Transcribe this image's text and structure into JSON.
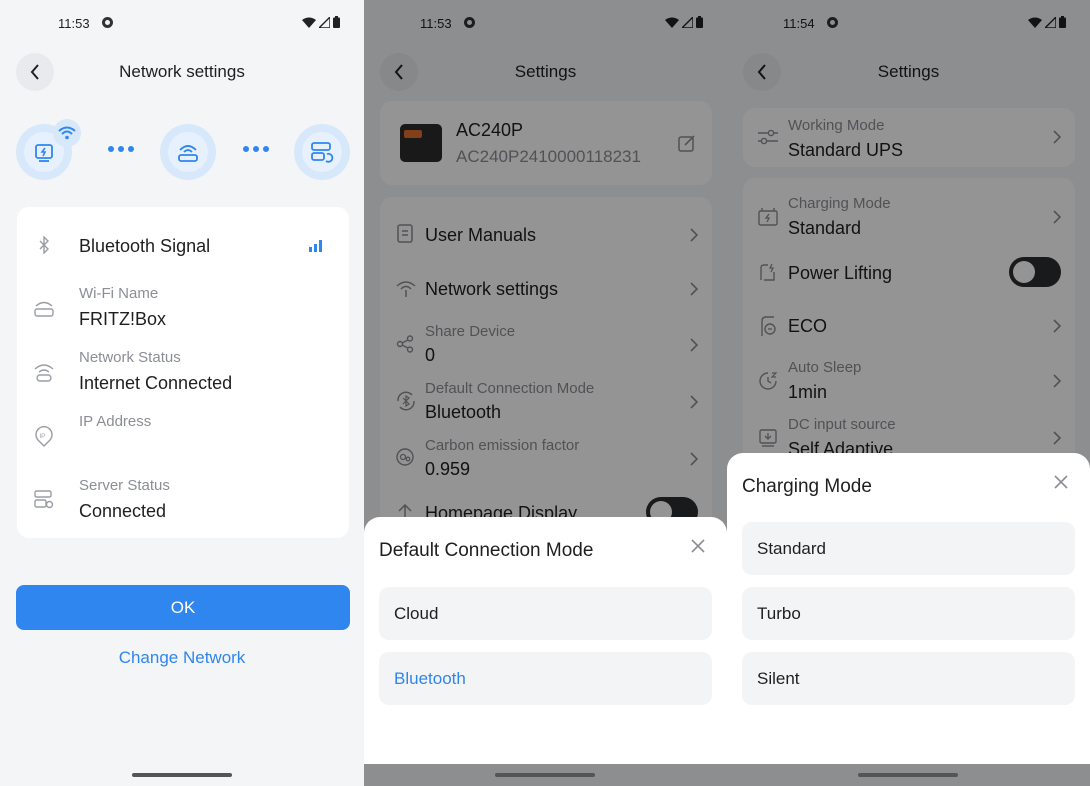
{
  "screen1": {
    "status_time": "11:53",
    "title": "Network settings",
    "rows": [
      {
        "label": "Bluetooth Signal"
      },
      {
        "label": "Wi-Fi Name",
        "value": "FRITZ!Box"
      },
      {
        "label": "Network Status",
        "value": "Internet Connected"
      },
      {
        "label": "IP Address",
        "value": ""
      },
      {
        "label": "Server Status",
        "value": "Connected"
      }
    ],
    "ok_label": "OK",
    "change_network_label": "Change Network",
    "accent_color": "#2f86ef"
  },
  "screen2": {
    "status_time": "11:53",
    "title": "Settings",
    "device": {
      "name": "AC240P",
      "serial": "AC240P2410000118231"
    },
    "items": [
      {
        "label": "User Manuals"
      },
      {
        "label": "Network settings"
      },
      {
        "label": "Share Device",
        "value": "0"
      },
      {
        "label": "Default Connection Mode",
        "value": "Bluetooth"
      },
      {
        "label": "Carbon emission factor",
        "value": "0.959"
      },
      {
        "label": "Homepage Display"
      }
    ],
    "sheet": {
      "title": "Default Connection Mode",
      "options": [
        "Cloud",
        "Bluetooth"
      ],
      "selected": "Bluetooth"
    }
  },
  "screen3": {
    "status_time": "11:54",
    "title": "Settings",
    "working_mode": {
      "label": "Working Mode",
      "value": "Standard UPS"
    },
    "items": [
      {
        "label": "Charging Mode",
        "value": "Standard"
      },
      {
        "label": "Power Lifting"
      },
      {
        "label": "ECO"
      },
      {
        "label": "Auto Sleep",
        "value": "1min"
      },
      {
        "label": "DC input source",
        "value": "Self Adaptive"
      }
    ],
    "sheet": {
      "title": "Charging Mode",
      "options": [
        "Standard",
        "Turbo",
        "Silent"
      ]
    }
  }
}
